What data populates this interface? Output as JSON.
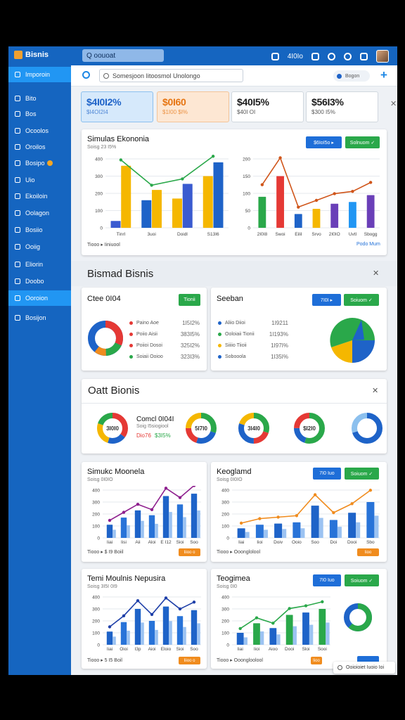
{
  "app": {
    "title": "Bisnis",
    "top_search": "Q  oouoat",
    "top_clock": "4I0Io"
  },
  "sidebar": {
    "items": [
      {
        "label": "Imporoin",
        "icon": "dashboard-icon",
        "active": true
      },
      {
        "label": "Bito",
        "icon": "bookmark-icon"
      },
      {
        "label": "Bos",
        "icon": "box-icon"
      },
      {
        "label": "Ocoolos",
        "icon": "circle-icon"
      },
      {
        "label": "Oroilos",
        "icon": "pen-icon"
      },
      {
        "label": "Bosipo",
        "icon": "badge-icon",
        "badge": true
      },
      {
        "label": "Uio",
        "icon": "circle-icon"
      },
      {
        "label": "Ekoiloin",
        "icon": "list-icon"
      },
      {
        "label": "Oolagon",
        "icon": "grid-icon"
      },
      {
        "label": "Bosiio",
        "icon": "square-icon"
      },
      {
        "label": "Ooiig",
        "icon": "arrow-icon"
      },
      {
        "label": "Eliorin",
        "icon": "refresh-icon"
      },
      {
        "label": "Doobo",
        "icon": "globe-icon"
      },
      {
        "label": "Ooroion",
        "icon": "folder-icon",
        "active": true
      },
      {
        "label": "Bosijon",
        "icon": "pencil-icon"
      }
    ]
  },
  "subbar": {
    "search_placeholder": "Somesjoon Iitoosmol Unolongo",
    "pill": "Bogon"
  },
  "kpis": [
    {
      "value": "$4I0I2%",
      "sub": "$I4OI2I4",
      "bg": "#d6e9fb",
      "border": "#8cc0ee",
      "color": "#1e63c8"
    },
    {
      "value": "$0I60",
      "sub": "$1I00 $I%",
      "bg": "#fde7d3",
      "border": "#f3c499",
      "color": "#e67512"
    },
    {
      "value": "$40I5%",
      "sub": "$40I OI",
      "bg": "#ffffff",
      "border": "#d0d7de",
      "color": "#1a1a1a"
    },
    {
      "value": "$56I3%",
      "sub": "$300 I5%",
      "bg": "#ffffff",
      "border": "#d0d7de",
      "color": "#1a1a1a"
    }
  ],
  "card1": {
    "title": "Simulas Ekononia",
    "sub": "Soisg 23 I5%",
    "btn1": "$6IoI5o  ▸",
    "btn2": "Solnuom ✓",
    "foot": "Tiooo  ▸  Iiniuool",
    "link": "Podo Mum",
    "chart_a": {
      "type": "bar",
      "y_ticks": [
        "400",
        "300",
        "200",
        "100",
        "0"
      ],
      "categories": [
        "Tinrl",
        "3uoi",
        "Doidl",
        "S13I6"
      ]
    },
    "chart_b": {
      "type": "bar",
      "y_ticks": [
        "200",
        "150",
        "100",
        "50",
        "0"
      ],
      "categories": [
        "2I0I8",
        "Swoi",
        "Eilil",
        "Srvo",
        "2I0IO",
        "Uvtl",
        "Sbogg"
      ]
    }
  },
  "sec1": {
    "title": "Bismad Bisnis"
  },
  "card_cte": {
    "title": "Ctee 0I04",
    "btn": "Tionii",
    "legend": [
      {
        "label": "Paino Aoe",
        "value": "1I5I2%",
        "color": "#e53935"
      },
      {
        "label": "Poiio Aisii",
        "value": "383I5%",
        "color": "#e53935"
      },
      {
        "label": "Poiioi Dosoi",
        "value": "325I2%",
        "color": "#e53935"
      },
      {
        "label": "Soiaii Ooioo",
        "value": "323I3%",
        "color": "#2aa84a"
      }
    ]
  },
  "card_seeban": {
    "title": "Seeban",
    "btn1": "7I0I  ▸",
    "btn2": "Soiuom ✓",
    "legend": [
      {
        "label": "Aliio Diioi",
        "value": "1I9211",
        "color": "#1e63c8"
      },
      {
        "label": "Ooloiaii Tionii",
        "value": "1I193%",
        "color": "#2aa84a"
      },
      {
        "label": "Siiiio Tiioii",
        "value": "1I97I%",
        "color": "#f5b700"
      },
      {
        "label": "Sobooola",
        "value": "1I35I%",
        "color": "#1e63c8"
      }
    ]
  },
  "sec2": {
    "title": "Oatt Bionis",
    "item_title": "Comcl 0I04I",
    "item_sub": "Soig I5siogiool",
    "item_val1": "Dio76",
    "item_val2": "$3I5%",
    "donut_labels": [
      "3I0I0",
      "5I7I0",
      "3I4I0",
      "$I2I0"
    ]
  },
  "card_sm": {
    "title": "Simukc Moonela",
    "sub": "Soisg 0I0IO",
    "foot": "Tiooo  ▸  $ I9  Boiil",
    "tag": "Iiioo o",
    "y_ticks": [
      "400",
      "300",
      "200",
      "100",
      "0"
    ],
    "x_ticks": [
      "Iiai",
      "Iisi",
      "Aii",
      "Aloi",
      "E I12",
      "Sioi",
      "Soo"
    ]
  },
  "card_kg": {
    "title": "Keoglamd",
    "sub": "Soisg 0I0IO",
    "btn1": "7I0  Iuo",
    "btn2": "Soiuom ✓",
    "foot": "Tiooo  ▸  Ooonglolool",
    "tag": "Iioo",
    "y_ticks": [
      "400",
      "300",
      "200",
      "100",
      "0"
    ],
    "x_ticks": [
      "Iiai",
      "Iioi",
      "Doiv",
      "Ooio",
      "Soo",
      "Doi",
      "Dooi",
      "Sbo"
    ]
  },
  "card_tm": {
    "title": "Temi Moulnis Nepusira",
    "sub": "Soisg 3I5I 0I9",
    "foot": "Tiooo  ▸  5 I5  Boil",
    "tag": "Iiioo o",
    "y_ticks": [
      "400",
      "300",
      "200",
      "100",
      "0"
    ],
    "x_ticks": [
      "Iiai",
      "Oioi",
      "I3p",
      "Aioi",
      "Eloio",
      "Sioi",
      "Soo"
    ]
  },
  "card_tg": {
    "title": "Teogimea",
    "sub": "Soisg 0I0",
    "btn1": "7I0  Iuo",
    "btn2": "Soiuom ✓",
    "foot": "Tiooo  ▸  Ooongloolool",
    "tag": "Iioo",
    "y_ticks": [
      "400",
      "300",
      "200",
      "100",
      "0"
    ],
    "x_ticks": [
      "Iiai",
      "Iioi",
      "Aioo",
      "Dooi",
      "Sloi",
      "Sooi"
    ]
  },
  "toast": {
    "label": "Ooioioiet Iuoio Ioi"
  },
  "colors": {
    "brand": "#1565c0",
    "accent": "#2196f3",
    "green": "#2aa84a",
    "orange": "#f08c1e",
    "red": "#e53935",
    "yellow": "#f5b700"
  },
  "chart_data": [
    {
      "type": "bar",
      "title": "Simulas Ekononia",
      "categories": [
        "Tinrl",
        "3uoi",
        "Doidl",
        "S13I6"
      ],
      "series": [
        {
          "values": [
            40,
            160,
            170,
            300
          ]
        },
        {
          "values": [
            360,
            220,
            255,
            380
          ]
        }
      ],
      "ylim": [
        0,
        400
      ]
    },
    {
      "type": "bar",
      "categories": [
        "2I0I8",
        "Swoi",
        "Eilil",
        "Srvo",
        "2I0IO",
        "Uvtl",
        "Sbogg"
      ],
      "series": [
        {
          "values": [
            90,
            150,
            40,
            55,
            70,
            75,
            95
          ]
        }
      ],
      "ylim": [
        0,
        200
      ]
    },
    {
      "type": "bar",
      "title": "Simukc Moonela",
      "categories": [
        "Iiai",
        "Iisi",
        "Aii",
        "Aloi",
        "E I12",
        "Sioi",
        "Soo"
      ],
      "series": [
        {
          "values": [
            110,
            170,
            230,
            190,
            350,
            280,
            370
          ]
        }
      ],
      "ylim": [
        0,
        400
      ]
    },
    {
      "type": "bar",
      "title": "Keoglamd",
      "categories": [
        "Iiai",
        "Iioi",
        "Doiv",
        "Ooio",
        "Soo",
        "Doi",
        "Dooi",
        "Sbo"
      ],
      "series": [
        {
          "values": [
            80,
            110,
            120,
            130,
            270,
            150,
            210,
            300
          ]
        }
      ],
      "ylim": [
        0,
        400
      ]
    },
    {
      "type": "bar",
      "title": "Temi Moulnis Nepusira",
      "categories": [
        "Iiai",
        "Oioi",
        "I3p",
        "Aioi",
        "Eloio",
        "Sioi",
        "Soo"
      ],
      "series": [
        {
          "values": [
            110,
            190,
            300,
            200,
            320,
            240,
            290
          ]
        }
      ],
      "ylim": [
        0,
        400
      ]
    },
    {
      "type": "bar",
      "title": "Teogimea",
      "categories": [
        "Iiai",
        "Iioi",
        "Aioo",
        "Dooi",
        "Sloi",
        "Sooi"
      ],
      "series": [
        {
          "values": [
            100,
            180,
            140,
            250,
            270,
            300
          ]
        }
      ],
      "ylim": [
        0,
        400
      ]
    }
  ]
}
